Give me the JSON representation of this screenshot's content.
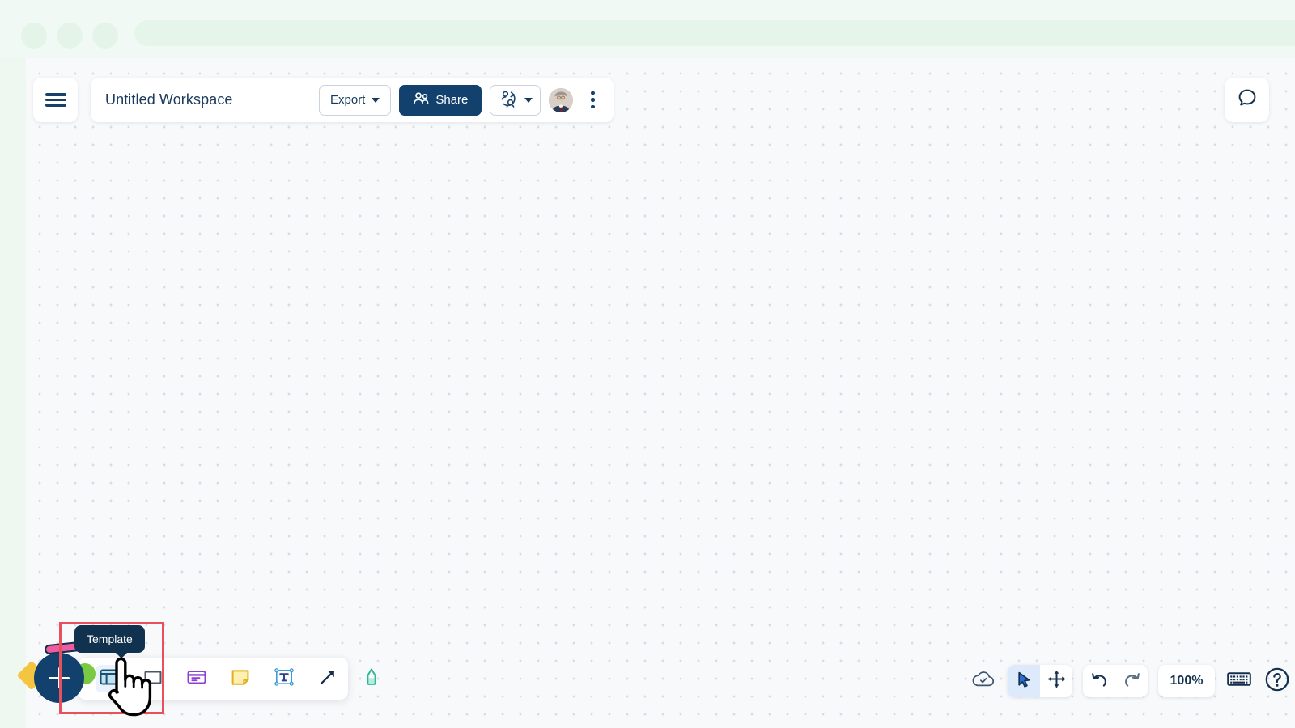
{
  "browser": {
    "dots": [
      "chrome-dot-1",
      "chrome-dot-2",
      "chrome-dot-3"
    ],
    "urlbar_value": ""
  },
  "header": {
    "menu_icon": "hamburger-menu-icon",
    "workspace_title": "Untitled Workspace",
    "workspace_title_placeholder": "Untitled Workspace",
    "export_label": "Export",
    "export_icon": "chevron-down-icon",
    "share_label": "Share",
    "share_icon": "people-group-icon",
    "presence_icon": "follow-user-icon",
    "presence_caret_icon": "chevron-down-icon",
    "avatar_label": "User avatar",
    "kebab_icon": "more-vertical-icon"
  },
  "right_rail": {
    "chat_icon": "chat-bubble-icon"
  },
  "create_toolbar": {
    "add_label": "+",
    "add_icon": "plus-icon",
    "tools": [
      {
        "name": "template",
        "label": "Template",
        "icon": "template-icon",
        "active": true
      },
      {
        "name": "shape",
        "label": "Shape",
        "icon": "shape-square-icon",
        "active": false
      },
      {
        "name": "card",
        "label": "Card",
        "icon": "card-icon",
        "active": false
      },
      {
        "name": "sticky-note",
        "label": "Sticky note",
        "icon": "sticky-note-icon",
        "active": false
      },
      {
        "name": "text",
        "label": "Text",
        "icon": "text-box-icon",
        "active": false
      },
      {
        "name": "connector",
        "label": "Arrow",
        "icon": "arrow-diagonal-icon",
        "active": false
      },
      {
        "name": "highlighter",
        "label": "Highlighter",
        "icon": "highlighter-pen-icon",
        "active": false
      }
    ],
    "tooltip_text": "Template"
  },
  "view_controls": {
    "save_status_icon": "cloud-check-icon",
    "select_icon": "cursor-arrow-icon",
    "pan_icon": "move-arrows-icon",
    "undo_icon": "undo-arrow-icon",
    "redo_icon": "redo-arrow-icon",
    "zoom_level": "100%",
    "keyboard_icon": "keyboard-icon",
    "help_icon": "help-question-icon"
  },
  "colors": {
    "brand_navy": "#12416e",
    "highlight_red": "#e8505b",
    "tooltip_bg": "#11324e",
    "canvas_bg": "#f8f9fb",
    "chrome_bg": "#f0f9f3",
    "active_blue": "#ddeafb"
  }
}
